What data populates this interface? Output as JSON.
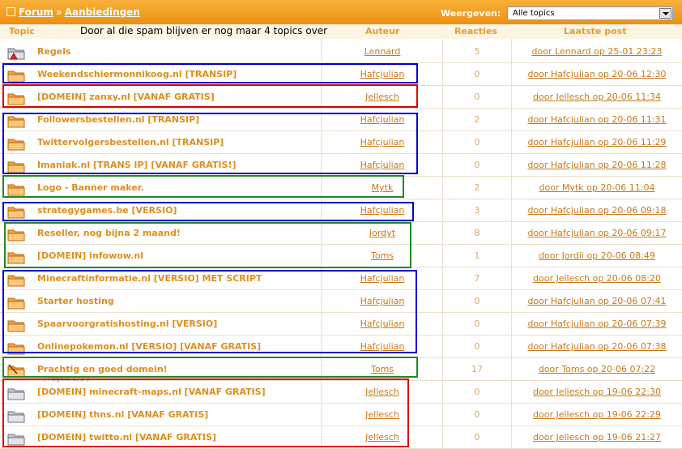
{
  "breadcrumb": {
    "forum": "Forum",
    "separator": "»",
    "section": "Aanbiedingen"
  },
  "filter": {
    "label": "Weergeven:",
    "selected": "Alle topics"
  },
  "header": {
    "topic": "Topic",
    "note": "Door al die spam blijven er nog maar 4 topics over",
    "author": "Auteur",
    "replies": "Reacties",
    "last_post": "Laatste post"
  },
  "colors": {
    "blue": "#0000cc",
    "red": "#dd0000",
    "green": "#1f8a1f",
    "orange": "#f0a030"
  },
  "topics": [
    {
      "title": "Regels",
      "author": "Lennard",
      "replies": "5",
      "last": "door Lennard op 25-01 23:23",
      "icon": "announcement-folder-icon"
    },
    {
      "title": "Weekendschiermonnikoog.nl [TRANSIP]",
      "author": "Hafcjulian",
      "replies": "0",
      "last": "door Hafcjulian op 20-06 12:30",
      "icon": "folder-icon"
    },
    {
      "title": "[DOMEIN] zanxy.nl [VANAF GRATIS]",
      "author": "Jellesch",
      "replies": "0",
      "last": "door Jellesch op 20-06 11:34",
      "icon": "folder-icon"
    },
    {
      "title": "Followersbestellen.nl [TRANSIP]",
      "author": "Hafcjulian",
      "replies": "2",
      "last": "door Hafcjulian op 20-06 11:31",
      "icon": "folder-icon"
    },
    {
      "title": "Twittervolgersbestellen.nl [TRANSIP]",
      "author": "Hafcjulian",
      "replies": "0",
      "last": "door Hafcjulian op 20-06 11:29",
      "icon": "folder-icon"
    },
    {
      "title": "Imaniak.nl [TRANS IP] [VANAF GRATIS!]",
      "author": "Hafcjulian",
      "replies": "0",
      "last": "door Hafcjulian op 20-06 11:28",
      "icon": "folder-icon"
    },
    {
      "title": "Logo - Banner maker.",
      "author": "Mytk",
      "replies": "2",
      "last": "door Mytk op 20-06 11:04",
      "icon": "folder-icon"
    },
    {
      "title": "strategygames.be [VERSIO]",
      "author": "Hafcjulian",
      "replies": "3",
      "last": "door Hafcjulian op 20-06 09:18",
      "icon": "folder-icon"
    },
    {
      "title": "Reseller, nog bijna 2 maand!",
      "author": "Jordyt",
      "replies": "8",
      "last": "door Hafcjulian op 20-06 09:17",
      "icon": "folder-icon"
    },
    {
      "title": "[DOMEIN] infowow.nl",
      "author": "Toms",
      "replies": "1",
      "last": "door Jordii op 20-06 08:49",
      "icon": "folder-icon"
    },
    {
      "title": "Minecraftinformatie.nl [VERSIO] MET SCRIPT",
      "author": "Hafcjulian",
      "replies": "7",
      "last": "door Jellesch op 20-06 08:20",
      "icon": "folder-icon"
    },
    {
      "title": "Starter hosting",
      "author": "Hafcjulian",
      "replies": "0",
      "last": "door Hafcjulian op 20-06 07:41",
      "icon": "folder-icon"
    },
    {
      "title": "Spaarvoorgratishosting.nl [VERSIO]",
      "author": "Hafcjulian",
      "replies": "0",
      "last": "door Hafcjulian op 20-06 07:39",
      "icon": "folder-icon"
    },
    {
      "title": "Onlinepokemon.nl [VERSIO] [VANAF GRATIS]",
      "author": "Hafcjulian",
      "replies": "0",
      "last": "door Hafcjulian op 20-06 07:38",
      "icon": "folder-icon"
    },
    {
      "title": "Prachtig en goed domein!",
      "author": "Toms",
      "replies": "17",
      "last": "door Toms op 20-06 07:22",
      "icon": "hot-folder-icon",
      "pages": {
        "prefix": "[ Pagina",
        "p1": "1",
        "sep": ",",
        "p2": "2",
        "suffix": "]"
      }
    },
    {
      "title": "[DOMEIN] minecraft-maps.nl [VANAF GRATIS]",
      "author": "Jellesch",
      "replies": "0",
      "last": "door Jellesch op 19-06 22:30",
      "icon": "grey-folder-icon"
    },
    {
      "title": "[DOMEIN] thns.nl [VANAF GRATIS]",
      "author": "Jellesch",
      "replies": "0",
      "last": "door Jellesch op 19-06 22:29",
      "icon": "grey-folder-icon"
    },
    {
      "title": "[DOMEIN] twitto.nl [VANAF GRATIS]",
      "author": "Jellesch",
      "replies": "0",
      "last": "door Jellesch op 19-06 21:27",
      "icon": "grey-folder-icon"
    }
  ]
}
